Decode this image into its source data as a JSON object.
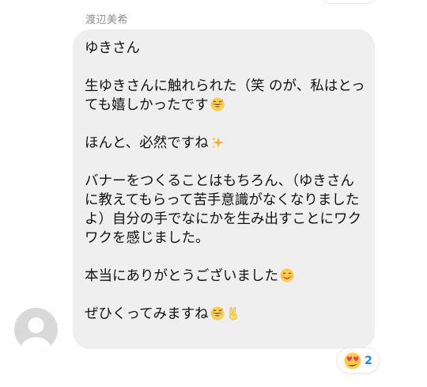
{
  "thread": {
    "sender_name": "渡辺美希"
  },
  "message": {
    "paragraphs": [
      {
        "text": "ゆきさん",
        "emojis": []
      },
      {
        "text": "生ゆきさんに触れられた（笑 のが、私はとっても嬉しかったです",
        "emojis": [
          "grinning-sweat-emoji"
        ]
      },
      {
        "text": "ほんと、必然ですね",
        "emojis": [
          "sparkles-emoji"
        ]
      },
      {
        "text": "バナーをつくることはもちろん、（ゆきさんに教えてもらって苦手意識がなくなりましたよ）自分の手でなにかを生み出すことにワクワクを感じました。",
        "emojis": []
      },
      {
        "text": "本当にありがとうございました",
        "emojis": [
          "smiling-blush-emoji"
        ]
      },
      {
        "text": "ぜひくってみますね",
        "emojis": [
          "grinning-sweat-emoji",
          "victory-hand-emoji"
        ]
      }
    ]
  },
  "reaction": {
    "icon": "heart-eyes-emoji",
    "count": "2",
    "count_color": "#1f86d8"
  },
  "avatar": {
    "icon": "default-avatar-icon"
  }
}
